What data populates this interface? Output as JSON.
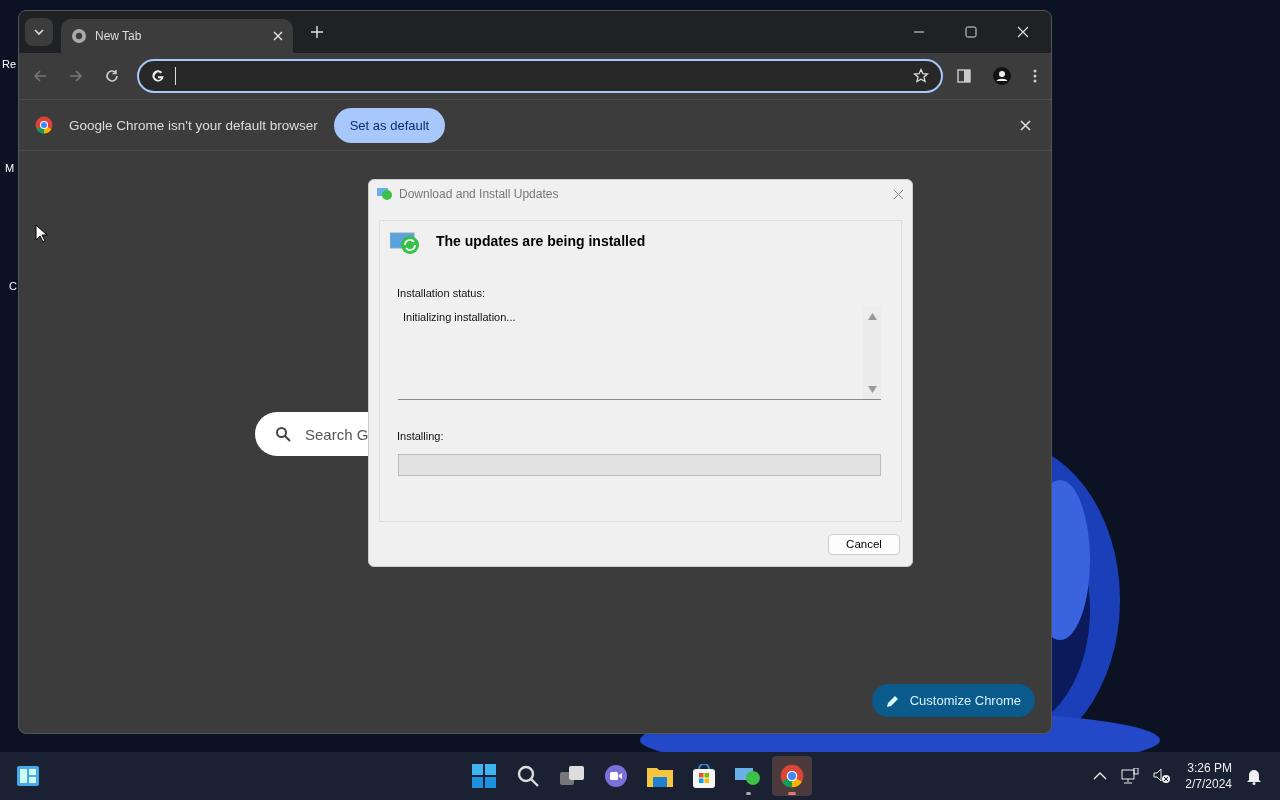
{
  "desktop": {
    "icon_labels": [
      "Re",
      "M",
      "C"
    ]
  },
  "browser": {
    "tabs": [
      {
        "title": "New Tab",
        "selected": true
      }
    ],
    "infobar": {
      "message": "Google Chrome isn't your default browser",
      "button": "Set as default"
    },
    "search": {
      "placeholder": "Search G"
    },
    "customize_button": "Customize Chrome"
  },
  "dialog": {
    "title": "Download and Install Updates",
    "heading": "The updates are being installed",
    "status_label": "Installation status:",
    "status_text": "Initializing installation...",
    "progress_label": "Installing:",
    "progress": {
      "level": 0
    },
    "button": "Cancel"
  },
  "taskbar": {
    "apps": [
      {
        "kind": "start",
        "running": false,
        "selected": false
      },
      {
        "kind": "search",
        "running": false,
        "selected": false
      },
      {
        "kind": "taskview",
        "running": false,
        "selected": false
      },
      {
        "kind": "chat",
        "running": false,
        "selected": false
      },
      {
        "kind": "explorer",
        "running": false,
        "selected": false
      },
      {
        "kind": "store",
        "running": false,
        "selected": false
      },
      {
        "kind": "updater",
        "running": true,
        "selected": false
      },
      {
        "kind": "chrome",
        "running": true,
        "selected": true
      }
    ],
    "time": "3:26 PM",
    "date": "2/7/2024"
  }
}
